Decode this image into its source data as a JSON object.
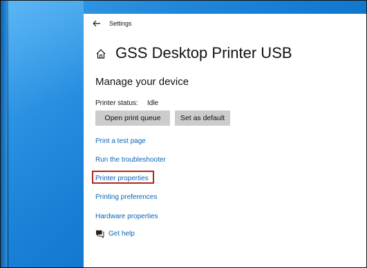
{
  "window": {
    "title": "Settings"
  },
  "page": {
    "title": "GSS Desktop Printer USB",
    "section_title": "Manage your device"
  },
  "status": {
    "label": "Printer status:",
    "value": "Idle"
  },
  "buttons": {
    "open_queue": "Open print queue",
    "set_default": "Set as default"
  },
  "links": {
    "print_test": "Print a test page",
    "troubleshooter": "Run the troubleshooter",
    "printer_properties": "Printer properties",
    "printing_preferences": "Printing preferences",
    "hardware_properties": "Hardware properties"
  },
  "help": {
    "label": "Get help"
  },
  "icons": {
    "back": "back-arrow-icon",
    "home": "home-icon",
    "help": "chat-help-icon"
  },
  "colors": {
    "link": "#0a63b6",
    "highlight": "#b42318",
    "button": "#cccccc"
  }
}
